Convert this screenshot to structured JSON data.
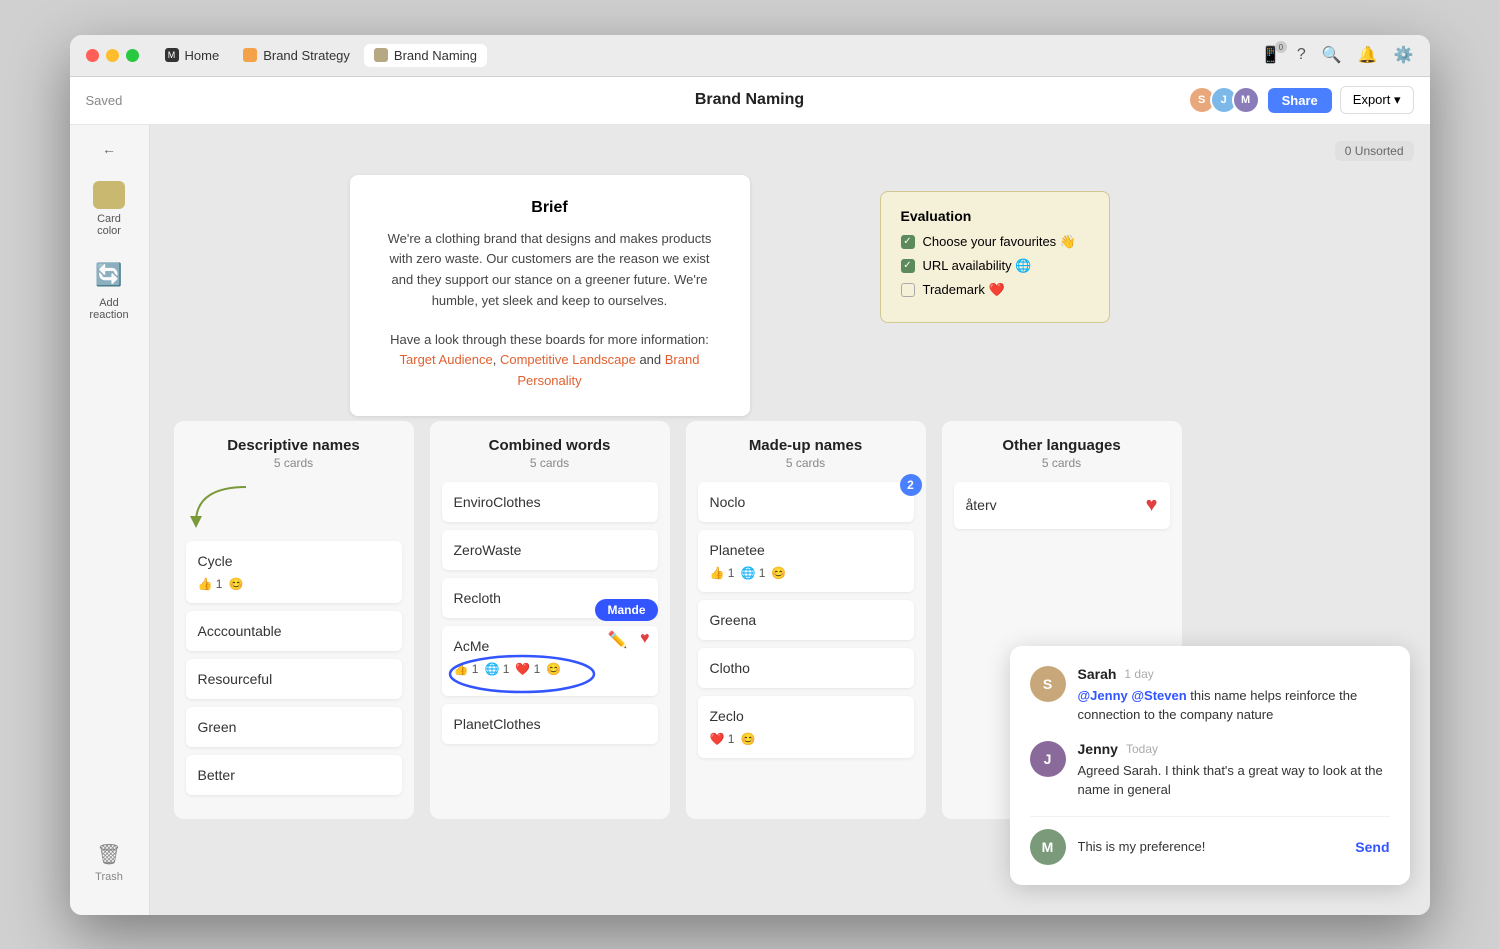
{
  "window": {
    "title": "Brand Naming"
  },
  "titlebar": {
    "tabs": [
      {
        "id": "home",
        "label": "Home",
        "icon": "M",
        "active": false
      },
      {
        "id": "brand-strategy",
        "label": "Brand Strategy",
        "icon": "orange",
        "active": false
      },
      {
        "id": "brand-naming",
        "label": "Brand Naming",
        "icon": "tan",
        "active": true
      }
    ]
  },
  "header": {
    "title": "Brand Naming",
    "saved_label": "Saved",
    "share_label": "Share",
    "export_label": "Export ▾",
    "avatars": [
      "S",
      "J",
      "M"
    ]
  },
  "sidebar": {
    "back_label": "←",
    "card_color_label": "Card color",
    "add_reaction_label": "Add reaction",
    "trash_label": "Trash"
  },
  "canvas": {
    "unsorted_label": "0 Unsorted"
  },
  "brief": {
    "title": "Brief",
    "body1": "We're a clothing brand that designs and makes products with zero waste. Our customers are the reason we exist and they support our stance on a greener future. We're humble, yet sleek and keep to ourselves.",
    "body2": "Have a look through these boards for more information:",
    "link1": "Target Audience",
    "link2": "Competitive Landscape",
    "link3": "Brand Personality"
  },
  "evaluation": {
    "title": "Evaluation",
    "items": [
      {
        "label": "Choose your favourites 👋",
        "checked": true
      },
      {
        "label": "URL availability 🌐",
        "checked": true
      },
      {
        "label": "Trademark ❤️",
        "checked": false
      }
    ]
  },
  "columns": [
    {
      "id": "descriptive",
      "title": "Descriptive names",
      "count": "5 cards",
      "cards": [
        {
          "name": "Cycle",
          "reactions": [
            {
              "emoji": "👍",
              "count": "1"
            },
            {
              "emoji": "😊",
              "count": ""
            }
          ]
        },
        {
          "name": "Acccountable",
          "reactions": []
        },
        {
          "name": "Resourceful",
          "reactions": []
        },
        {
          "name": "Green",
          "reactions": []
        },
        {
          "name": "Better",
          "reactions": []
        }
      ]
    },
    {
      "id": "combined",
      "title": "Combined words",
      "count": "5 cards",
      "cards": [
        {
          "name": "EnviroClothes",
          "reactions": [],
          "annotated": false
        },
        {
          "name": "ZeroWaste",
          "reactions": [],
          "annotated": false
        },
        {
          "name": "Recloth",
          "reactions": [],
          "annotated": false
        },
        {
          "name": "AcMe",
          "reactions": [
            {
              "emoji": "👍",
              "count": "1"
            },
            {
              "emoji": "🌐",
              "count": "1"
            },
            {
              "emoji": "❤️",
              "count": "1"
            },
            {
              "emoji": "😊",
              "count": ""
            }
          ],
          "annotated": true,
          "mande": "Mande"
        },
        {
          "name": "PlanetClothes",
          "reactions": [],
          "annotated": false
        }
      ]
    },
    {
      "id": "madeup",
      "title": "Made-up names",
      "count": "5 cards",
      "cards": [
        {
          "name": "Noclo",
          "reactions": [],
          "badge": "2"
        },
        {
          "name": "Planetee",
          "reactions": [
            {
              "emoji": "👍",
              "count": "1"
            },
            {
              "emoji": "🌐",
              "count": "1"
            },
            {
              "emoji": "😊",
              "count": ""
            }
          ]
        },
        {
          "name": "Greena",
          "reactions": []
        },
        {
          "name": "Clotho",
          "reactions": []
        },
        {
          "name": "Zeclo",
          "reactions": [
            {
              "emoji": "❤️",
              "count": "1"
            },
            {
              "emoji": "😊",
              "count": ""
            }
          ]
        }
      ]
    },
    {
      "id": "other",
      "title": "Other languages",
      "count": "5 cards",
      "cards": [
        {
          "name": "återv",
          "reactions": [],
          "has_heart": true
        }
      ]
    }
  ],
  "comments": [
    {
      "author": "Sarah",
      "time": "1 day",
      "text": "@Jenny @Steven this name helps reinforce the connection to the company nature",
      "avatar_initial": "S",
      "avatar_color": "sarah"
    },
    {
      "author": "Jenny",
      "time": "Today",
      "text": "Agreed Sarah. I think that's a great way to look at the name in general",
      "avatar_initial": "J",
      "avatar_color": "jenny"
    }
  ],
  "comment_input": {
    "placeholder": "This is my preference!",
    "send_label": "Send"
  },
  "icons": {
    "phone": "📱",
    "question": "?",
    "search": "🔍",
    "bell": "🔔",
    "gear": "⚙️",
    "check": "✓",
    "pencil": "✏️"
  }
}
